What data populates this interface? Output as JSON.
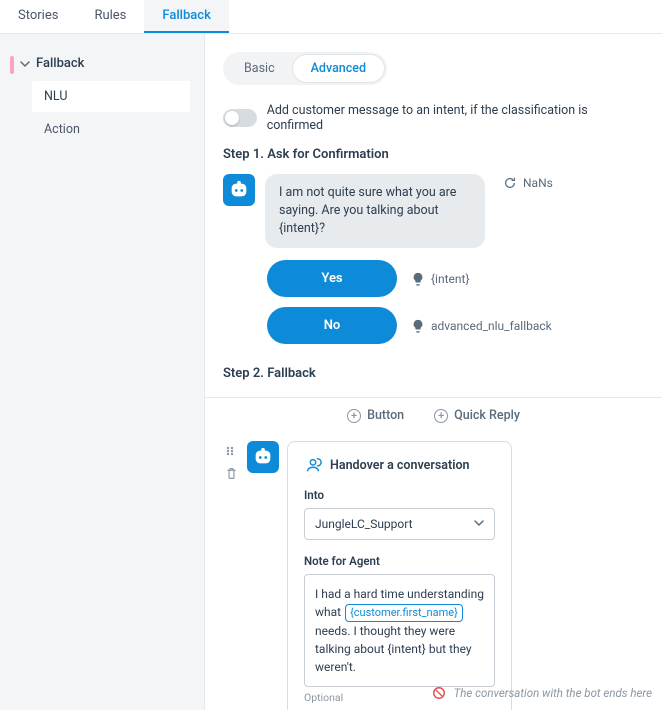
{
  "tabs": {
    "stories": "Stories",
    "rules": "Rules",
    "fallback": "Fallback"
  },
  "sidebar": {
    "section": "Fallback",
    "items": [
      "NLU",
      "Action"
    ]
  },
  "modes": {
    "basic": "Basic",
    "advanced": "Advanced"
  },
  "toggle_text": "Add customer message to an intent, if the classification is confirmed",
  "step1": {
    "title": "Step 1. Ask for Confirmation",
    "prompt": "I am not quite sure what you are saying. Are you talking about {intent}?",
    "meta": "NaNs",
    "yes": {
      "label": "Yes",
      "intent": "{intent}"
    },
    "no": {
      "label": "No",
      "intent": "advanced_nlu_fallback"
    }
  },
  "step2": {
    "title": "Step 2. Fallback"
  },
  "add": {
    "button": "Button",
    "quick_reply": "Quick Reply"
  },
  "handover": {
    "title": "Handover a conversation",
    "into_label": "Into",
    "into_value": "JungleLC_Support",
    "note_label": "Note for Agent",
    "note_before": "I had a hard time understanding what ",
    "note_var": "{customer.first_name}",
    "note_after": " needs. I thought they were talking about {intent} but they weren't.",
    "optional": "Optional"
  },
  "footer": "The conversation with the bot ends here"
}
